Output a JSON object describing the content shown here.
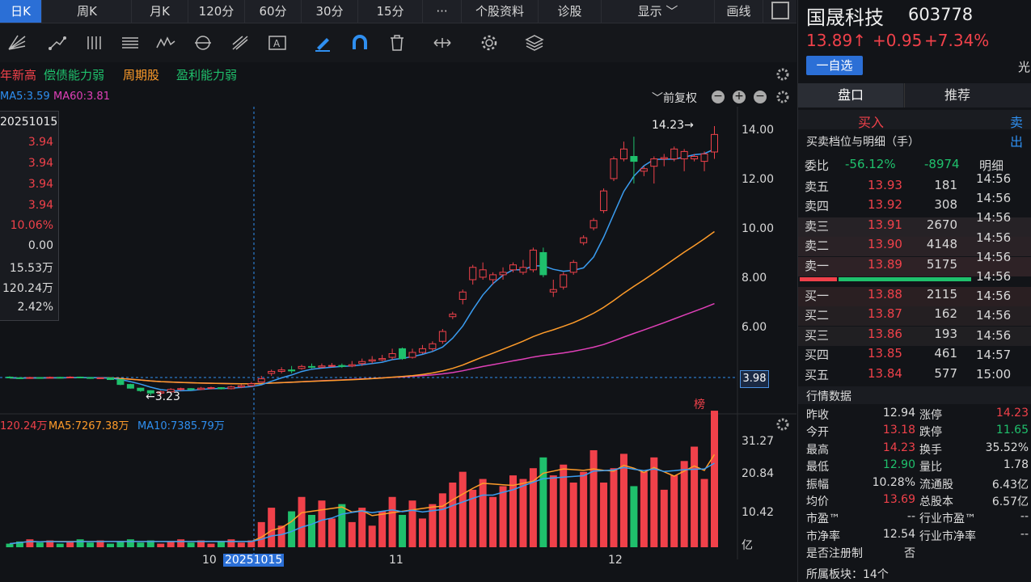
{
  "timeframes": [
    "日K",
    "周K",
    "月K",
    "120分",
    "60分",
    "30分",
    "15分",
    "···",
    "个股资料",
    "诊股",
    "显示 ﹀",
    "画线"
  ],
  "tags": [
    "年新高",
    "偿债能力弱",
    "周期股",
    "盈利能力弱"
  ],
  "ma_row": {
    "ma5": "MA5:3.59",
    "ma60": "MA60:3.81",
    "fq": "﹀前复权"
  },
  "infobox": {
    "date": "20251015",
    "values": [
      "3.94",
      "3.94",
      "3.94",
      "3.94",
      "10.06%",
      "0.00",
      "15.53万",
      "120.24万",
      "2.42%"
    ]
  },
  "chart_labels": {
    "high": "14.23→",
    "low": "←3.23",
    "current": "3.98",
    "bang": "榜"
  },
  "price_axis": [
    "14.00",
    "12.00",
    "10.00",
    "8.00",
    "6.00"
  ],
  "vol_axis": [
    "31.27",
    "20.84",
    "10.42",
    "亿"
  ],
  "vol_row": {
    "vol": "120.24万",
    "ma5": "MA5:7267.38万",
    "ma10": "MA10:7385.79万"
  },
  "date_axis": [
    "10",
    "20251015",
    "11",
    "12"
  ],
  "stock": {
    "name": "国晟科技",
    "code": "603778",
    "price": "13.89↑",
    "change": "+0.95",
    "pct": "+7.34%",
    "watch": "一自选",
    "extra": "光"
  },
  "tabs": [
    "盘口",
    "推荐"
  ],
  "buy_sell": {
    "buy": "买入",
    "sell": "卖出"
  },
  "order_title": "买卖档位与明细（手）",
  "weibi": {
    "label": "委比",
    "pct": "-56.12%",
    "diff": "-8974",
    "detail": "明细"
  },
  "asks": [
    {
      "label": "卖五",
      "price": "13.93",
      "vol": "181"
    },
    {
      "label": "卖四",
      "price": "13.92",
      "vol": "308"
    },
    {
      "label": "卖三",
      "price": "13.91",
      "vol": "2670"
    },
    {
      "label": "卖二",
      "price": "13.90",
      "vol": "4148"
    },
    {
      "label": "卖一",
      "price": "13.89",
      "vol": "5175"
    }
  ],
  "bids": [
    {
      "label": "买一",
      "price": "13.88",
      "vol": "2115"
    },
    {
      "label": "买二",
      "price": "13.87",
      "vol": "162"
    },
    {
      "label": "买三",
      "price": "13.86",
      "vol": "193"
    },
    {
      "label": "买四",
      "price": "13.85",
      "vol": "461"
    },
    {
      "label": "买五",
      "price": "13.84",
      "vol": "577"
    }
  ],
  "times": [
    "14:56",
    "14:56",
    "14:56",
    "14:56",
    "14:56",
    "14:56",
    "14:56",
    "14:56",
    "14:56",
    "14:57",
    "15:00"
  ],
  "market_title": "行情数据",
  "market": [
    [
      "昨收",
      "12.94",
      "涨停",
      "14.23"
    ],
    [
      "今开",
      "13.18",
      "跌停",
      "11.65"
    ],
    [
      "最高",
      "14.23",
      "换手",
      "35.52%"
    ],
    [
      "最低",
      "12.90",
      "量比",
      "1.78"
    ],
    [
      "振幅",
      "10.28%",
      "流通股",
      "6.43亿"
    ],
    [
      "均价",
      "13.69",
      "总股本",
      "6.57亿"
    ],
    [
      "市盈™",
      "--",
      "行业市盈™",
      "--"
    ],
    [
      "市净率",
      "12.54",
      "行业市净率",
      "--"
    ],
    [
      "是否注册制",
      "否",
      "",
      ""
    ]
  ],
  "sector": "所属板块：14个",
  "colors": {
    "up": "#f0414a",
    "down": "#1fc06c",
    "ma5": "#3a9cf0",
    "ma10": "#ff9c2a",
    "ma20": "#e040b8"
  },
  "chart_data": {
    "type": "candlestick",
    "y_ticks": [
      14,
      12,
      10,
      8,
      6
    ],
    "candles": [
      [
        4.05,
        4.02,
        4.08,
        4.0
      ],
      [
        4.02,
        4.0,
        4.05,
        3.98
      ],
      [
        4.0,
        4.03,
        4.06,
        3.98
      ],
      [
        4.03,
        4.01,
        4.05,
        3.99
      ],
      [
        4.01,
        4.04,
        4.07,
        4.0
      ],
      [
        4.04,
        4.02,
        4.06,
        4.0
      ],
      [
        4.02,
        4.05,
        4.08,
        4.01
      ],
      [
        4.05,
        4.03,
        4.07,
        4.01
      ],
      [
        4.03,
        4.0,
        4.05,
        3.98
      ],
      [
        4.0,
        4.02,
        4.04,
        3.98
      ],
      [
        4.02,
        3.95,
        4.03,
        3.93
      ],
      [
        3.95,
        3.75,
        3.96,
        3.72
      ],
      [
        3.75,
        3.6,
        3.78,
        3.58
      ],
      [
        3.6,
        3.5,
        3.62,
        3.45
      ],
      [
        3.5,
        3.4,
        3.52,
        3.3
      ],
      [
        3.4,
        3.45,
        3.5,
        3.23
      ],
      [
        3.45,
        3.55,
        3.6,
        3.4
      ],
      [
        3.55,
        3.58,
        3.62,
        3.5
      ],
      [
        3.58,
        3.55,
        3.6,
        3.5
      ],
      [
        3.55,
        3.6,
        3.65,
        3.52
      ],
      [
        3.6,
        3.62,
        3.66,
        3.55
      ],
      [
        3.62,
        3.58,
        3.64,
        3.55
      ],
      [
        3.58,
        3.65,
        3.7,
        3.55
      ],
      [
        3.65,
        3.7,
        3.75,
        3.6
      ],
      [
        3.7,
        3.78,
        3.85,
        3.65
      ],
      [
        3.85,
        3.98,
        4.1,
        3.85
      ],
      [
        4.2,
        4.28,
        4.35,
        4.1
      ],
      [
        4.28,
        4.34,
        4.45,
        4.2
      ],
      [
        4.34,
        4.3,
        4.5,
        4.2
      ],
      [
        4.4,
        4.48,
        4.55,
        4.35
      ],
      [
        4.48,
        4.45,
        4.6,
        4.4
      ],
      [
        4.45,
        4.5,
        4.6,
        4.42
      ],
      [
        4.5,
        4.52,
        4.62,
        4.45
      ],
      [
        4.52,
        4.48,
        4.6,
        4.42
      ],
      [
        4.5,
        4.55,
        4.7,
        4.45
      ],
      [
        4.6,
        4.68,
        4.8,
        4.5
      ],
      [
        4.7,
        4.75,
        4.9,
        4.6
      ],
      [
        4.75,
        4.8,
        4.95,
        4.7
      ],
      [
        4.85,
        5.0,
        5.2,
        4.75
      ],
      [
        5.2,
        4.8,
        5.25,
        4.75
      ],
      [
        4.85,
        5.05,
        5.2,
        4.8
      ],
      [
        5.05,
        5.2,
        5.35,
        5.0
      ],
      [
        5.2,
        5.4,
        5.5,
        5.1
      ],
      [
        5.5,
        5.9,
        6.0,
        5.4
      ],
      [
        6.5,
        6.6,
        6.7,
        6.4
      ],
      [
        7.2,
        7.5,
        7.6,
        7.0
      ],
      [
        8.0,
        8.5,
        8.6,
        7.8
      ],
      [
        8.1,
        8.4,
        8.7,
        8.0
      ],
      [
        8.0,
        8.2,
        8.3,
        7.8
      ],
      [
        8.2,
        8.3,
        8.5,
        8.0
      ],
      [
        8.4,
        8.6,
        8.7,
        8.3
      ],
      [
        8.3,
        8.5,
        8.8,
        8.2
      ],
      [
        8.4,
        9.2,
        9.3,
        8.3
      ],
      [
        9.1,
        8.2,
        9.3,
        8.1
      ],
      [
        7.5,
        7.6,
        8.0,
        7.3
      ],
      [
        7.7,
        8.2,
        8.3,
        7.6
      ],
      [
        8.3,
        8.7,
        8.8,
        8.2
      ],
      [
        9.5,
        9.7,
        9.8,
        9.4
      ],
      [
        10.1,
        10.4,
        10.5,
        10.0
      ],
      [
        10.8,
        11.6,
        11.7,
        10.7
      ],
      [
        12.1,
        12.9,
        13.0,
        12.0
      ],
      [
        12.9,
        13.3,
        13.6,
        12.8
      ],
      [
        13.0,
        12.8,
        13.8,
        11.9
      ],
      [
        12.4,
        12.5,
        12.6,
        12.2
      ],
      [
        12.6,
        12.9,
        13.0,
        11.9
      ],
      [
        12.9,
        12.95,
        13.1,
        12.6
      ],
      [
        12.9,
        13.3,
        13.4,
        12.8
      ],
      [
        12.9,
        13.2,
        13.3,
        12.4
      ],
      [
        12.9,
        13.0,
        13.1,
        12.8
      ],
      [
        12.8,
        13.1,
        13.2,
        12.4
      ],
      [
        13.18,
        13.89,
        14.23,
        12.9
      ]
    ],
    "ma5_label": "MA5",
    "ma60_label": "MA60",
    "vol_ticks": [
      31.27,
      20.84,
      10.42
    ]
  }
}
